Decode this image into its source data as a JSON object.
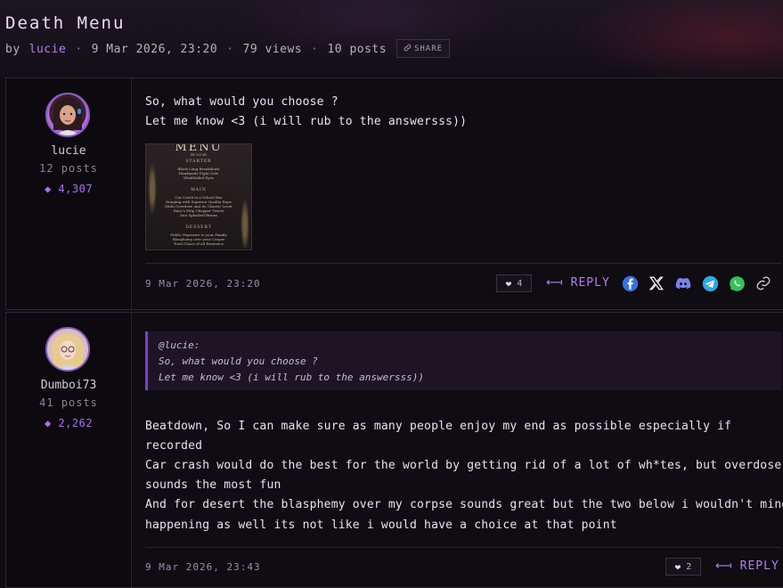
{
  "thread": {
    "title": "Death Menu",
    "by_label": "by",
    "author": "lucie",
    "date": "9 Mar 2026, 23:20",
    "views": "79 views",
    "posts": "10 posts",
    "share_label": "SHARE",
    "share_icon": "link-icon"
  },
  "posts": [
    {
      "username": "lucie",
      "post_count": "12 posts",
      "reputation": "4,307",
      "lines": [
        "So, what would you choose ?",
        "Let me know <3 (i will rub to the answersss))"
      ],
      "image": {
        "title": "MENU",
        "subtitle": "BY LUCIE",
        "sections": [
          {
            "heading": "STARTER",
            "items": [
              "Black Lung Breakdown",
              "Handmade Fight Cuts",
              "Windfolded Eyes"
            ]
          },
          {
            "heading": "MAIN",
            "items": [
              "Car Crash in a School Bus",
              "Hanging with Superior Quality Rope",
              "Multi Overdose and its Chaotic Lover",
              "Barn's Pulp Chopper Twists",
              "Gun Splashed Brains"
            ]
          },
          {
            "heading": "DESSERT",
            "items": [
              "Public Exposure to your Family",
              "Blasphemy over your Corpse",
              "Total Chaos of all Existence"
            ]
          }
        ]
      },
      "timestamp": "9 Mar 2026, 23:20",
      "likes": "4",
      "reply_label": "REPLY",
      "share_networks": [
        "facebook-icon",
        "x-icon",
        "discord-icon",
        "telegram-icon",
        "whatsapp-icon",
        "link-icon"
      ],
      "colors": {
        "facebook": "#3b6fe0",
        "x": "#ffffff",
        "discord": "#7b83f4",
        "telegram": "#2fa6e1",
        "whatsapp": "#36c15f",
        "link": "#c9c3d2"
      }
    },
    {
      "username": "Dumboi73",
      "post_count": "41 posts",
      "reputation": "2,262",
      "quote": {
        "author": "@lucie:",
        "lines": [
          "So, what would you choose ?",
          "Let me know <3 (i will rub to the answersss))"
        ]
      },
      "lines": [
        "Beatdown, So I can make sure as many people enjoy my end as possible especially if",
        "recorded",
        "Car crash would do the best for the world by getting rid of a lot of wh*tes, but overdose",
        "sounds the most fun",
        "And for desert the blasphemy over my corpse sounds great but the two below i wouldn't mind",
        "happening as well its not like i would have a choice at that point"
      ],
      "timestamp": "9 Mar 2026, 23:43",
      "likes": "2",
      "reply_label": "REPLY"
    }
  ],
  "accent_color": "#b57ef0",
  "reputation_icon": "diamond-icon",
  "like_icon": "heart-icon",
  "reply_icon": "reply-arrow-icon"
}
